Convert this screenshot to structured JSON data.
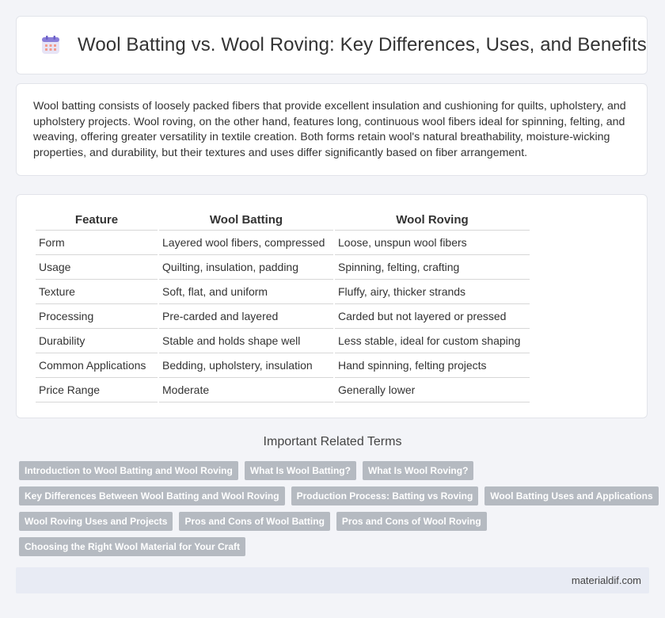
{
  "header": {
    "title": "Wool Batting vs. Wool Roving: Key Differences, Uses, and Benefits",
    "icon": "calendar-icon"
  },
  "intro": {
    "text": "Wool batting consists of loosely packed fibers that provide excellent insulation and cushioning for quilts, upholstery, and upholstery projects. Wool roving, on the other hand, features long, continuous wool fibers ideal for spinning, felting, and weaving, offering greater versatility in textile creation. Both forms retain wool's natural breathability, moisture-wicking properties, and durability, but their textures and uses differ significantly based on fiber arrangement."
  },
  "table": {
    "headers": [
      "Feature",
      "Wool Batting",
      "Wool Roving"
    ],
    "rows": [
      [
        "Form",
        "Layered wool fibers, compressed",
        "Loose, unspun wool fibers"
      ],
      [
        "Usage",
        "Quilting, insulation, padding",
        "Spinning, felting, crafting"
      ],
      [
        "Texture",
        "Soft, flat, and uniform",
        "Fluffy, airy, thicker strands"
      ],
      [
        "Processing",
        "Pre-carded and layered",
        "Carded but not layered or pressed"
      ],
      [
        "Durability",
        "Stable and holds shape well",
        "Less stable, ideal for custom shaping"
      ],
      [
        "Common Applications",
        "Bedding, upholstery, insulation",
        "Hand spinning, felting projects"
      ],
      [
        "Price Range",
        "Moderate",
        "Generally lower"
      ]
    ]
  },
  "related": {
    "title": "Important Related Terms",
    "tags": [
      [
        "Introduction to Wool Batting and Wool Roving",
        "What Is Wool Batting?",
        "What Is Wool Roving?"
      ],
      [
        "Key Differences Between Wool Batting and Wool Roving",
        "Production Process: Batting vs Roving",
        "Wool Batting Uses and Applications"
      ],
      [
        "Wool Roving Uses and Projects",
        "Pros and Cons of Wool Batting",
        "Pros and Cons of Wool Roving"
      ],
      [
        "Choosing the Right Wool Material for Your Craft"
      ]
    ]
  },
  "footer": {
    "site": "materialdif.com"
  }
}
